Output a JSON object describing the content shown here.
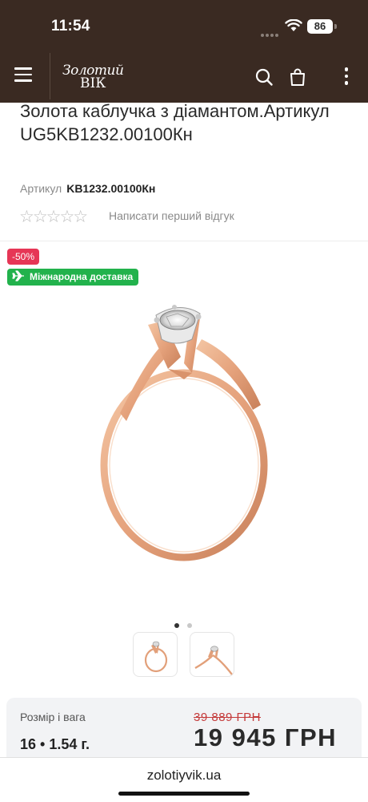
{
  "status_bar": {
    "time": "11:54",
    "battery": "86"
  },
  "header": {
    "logo_line1": "Золотий",
    "logo_line2": "ВІК",
    "icons": [
      "menu-icon",
      "search-icon",
      "shopping-bag-icon",
      "more-vertical-icon"
    ]
  },
  "product": {
    "title": "Золота каблучка з діамантом.Артикул UG5KB1232.00100Кн",
    "sku_label": "Артикул",
    "sku_value": "KB1232.00100Кн",
    "stars": "☆☆☆☆☆",
    "rating": 0,
    "review_link": "Написати перший відгук"
  },
  "badges": {
    "sale": "-50%",
    "shipping": "Міжнародна доставка"
  },
  "gallery": {
    "pages": 2,
    "active": 1
  },
  "price": {
    "size_label": "Розмір і вага",
    "size_value": "16 • 1.54 г.",
    "old_price": "39 889 ГРН",
    "new_price": "19 945 ГРН"
  },
  "browser": {
    "url": "zolotiyvik.ua"
  },
  "colors": {
    "header_bg": "#3a2a22",
    "sale_badge": "#e63656",
    "shipping_badge": "#22b24c",
    "old_price": "#c43a3a"
  }
}
